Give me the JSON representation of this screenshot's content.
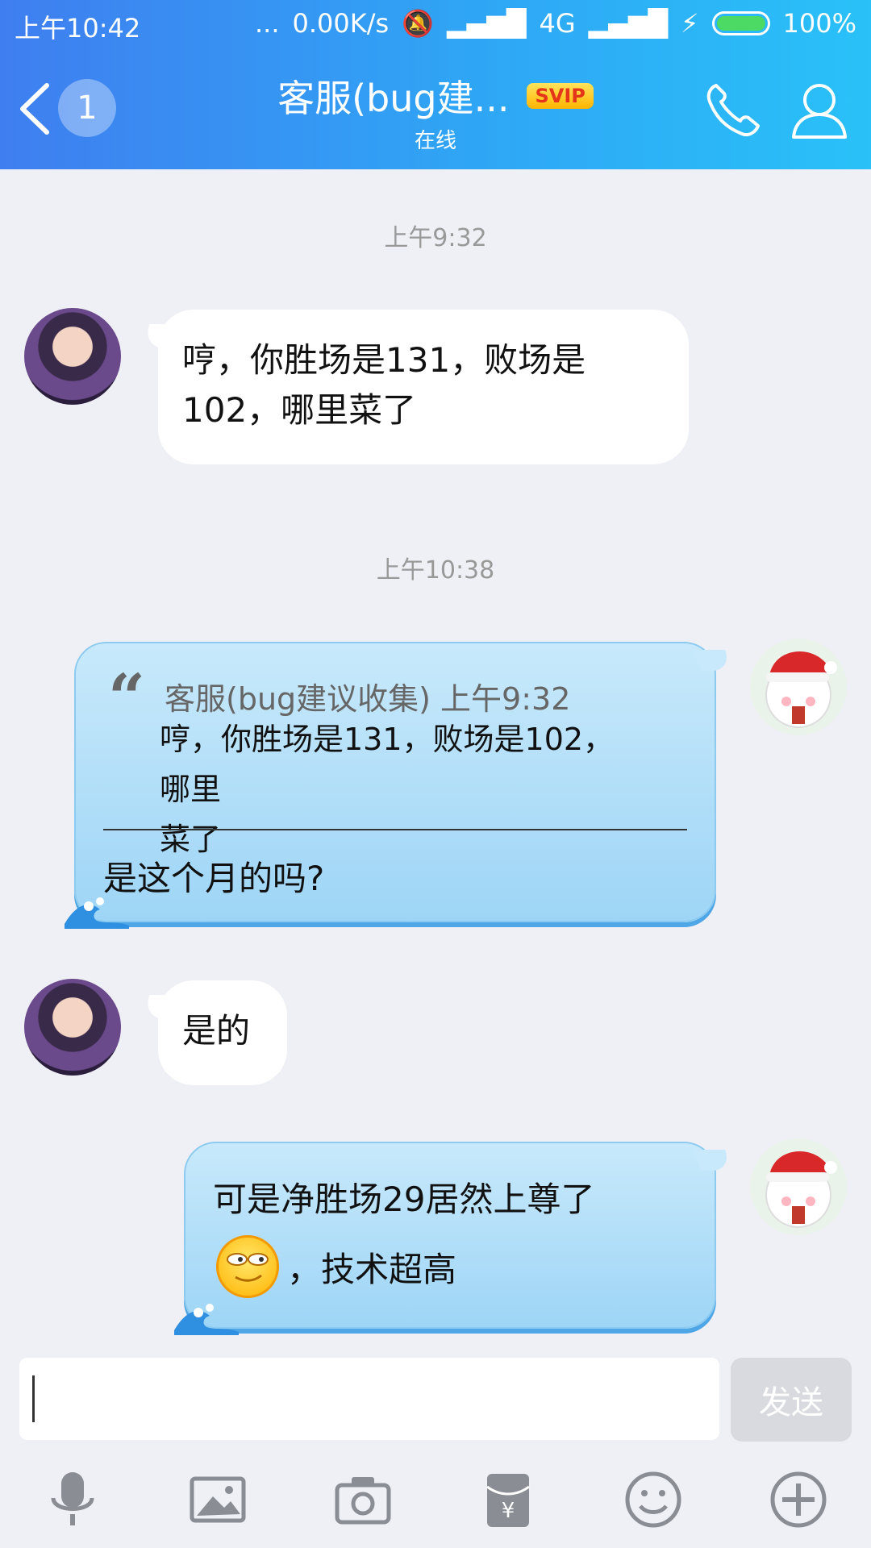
{
  "status_bar": {
    "time": "上午10:42",
    "dots": "...",
    "speed": "0.00K/s",
    "network": "4G",
    "battery": "100%"
  },
  "header": {
    "unread_count": "1",
    "title": "客服(bug建...",
    "badge": "SVIP",
    "subtitle": "在线"
  },
  "timestamps": [
    "上午9:32",
    "上午10:38"
  ],
  "messages": [
    {
      "from": "other",
      "line1": "哼，你胜场是131，败场是",
      "line2": "102，哪里菜了"
    },
    {
      "from": "me",
      "quote": {
        "author_time": "客服(bug建议收集) 上午9:32",
        "line1": "哼，你胜场是131，败场是102，哪里",
        "line2": "菜了"
      },
      "text": "是这个月的吗?"
    },
    {
      "from": "other",
      "text": "是的"
    },
    {
      "from": "me",
      "line1": "可是净胜场29居然上尊了",
      "line2": "，技术超高"
    }
  ],
  "input": {
    "placeholder": "",
    "send_label": "发送"
  },
  "toolbar": [
    "microphone-icon",
    "image-icon",
    "camera-icon",
    "red-packet-icon",
    "emoji-icon",
    "plus-icon"
  ]
}
